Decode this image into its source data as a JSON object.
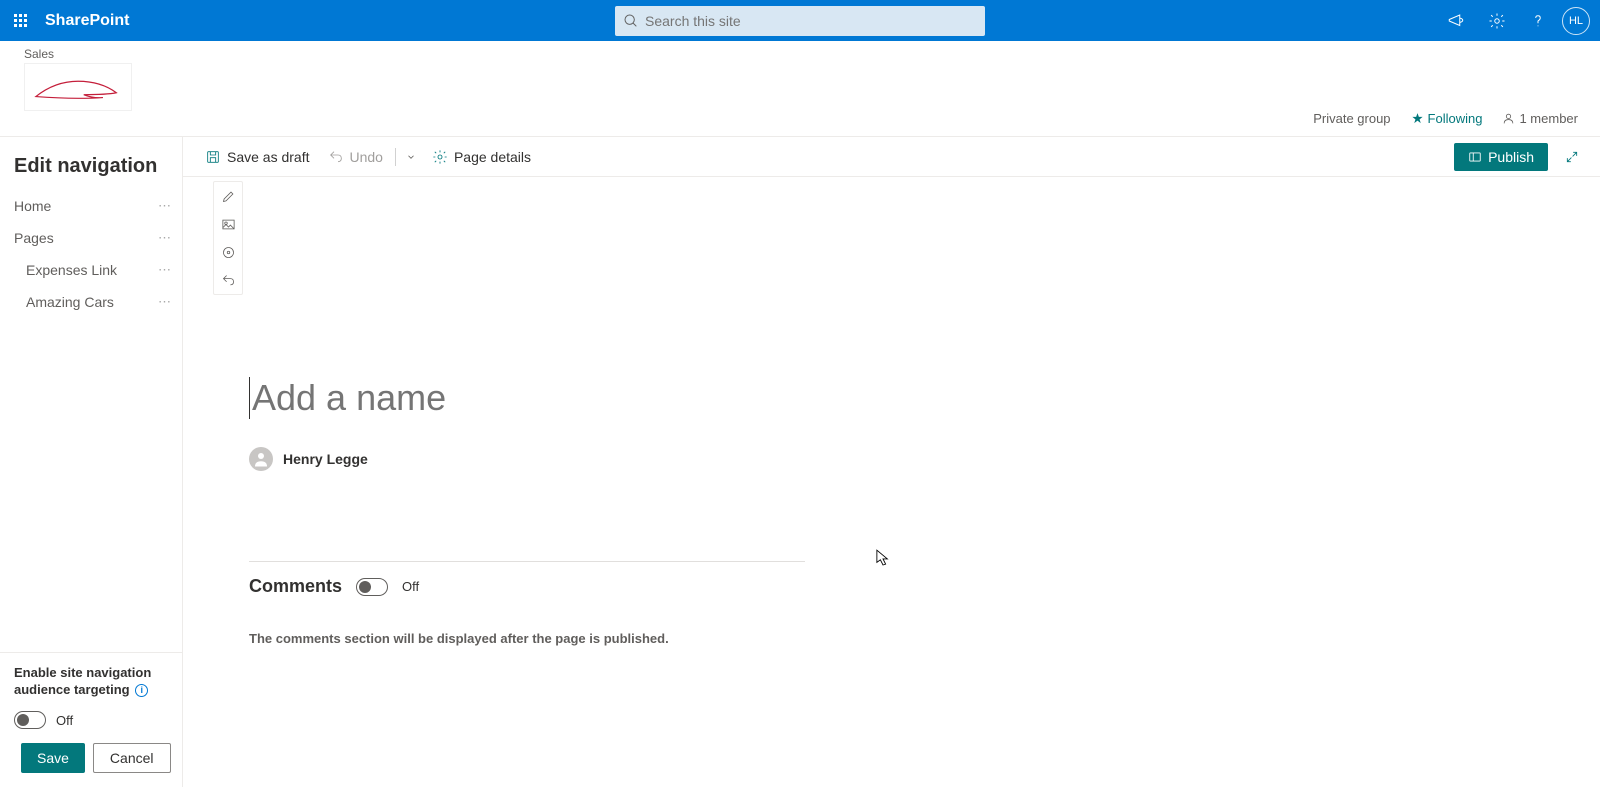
{
  "suiteBar": {
    "appTitle": "SharePoint",
    "searchPlaceholder": "Search this site",
    "userInitials": "HL"
  },
  "site": {
    "name": "Sales",
    "groupType": "Private group",
    "following": "Following",
    "members": "1 member"
  },
  "navPanel": {
    "title": "Edit navigation",
    "items": [
      {
        "label": "Home",
        "indent": false
      },
      {
        "label": "Pages",
        "indent": false
      },
      {
        "label": "Expenses Link",
        "indent": true
      },
      {
        "label": "Amazing Cars",
        "indent": true
      }
    ],
    "audienceLabel": "Enable site navigation audience targeting",
    "audienceToggleState": "Off",
    "saveLabel": "Save",
    "cancelLabel": "Cancel"
  },
  "cmdBar": {
    "saveAsDraft": "Save as draft",
    "undo": "Undo",
    "pageDetails": "Page details",
    "publish": "Publish"
  },
  "page": {
    "titlePlaceholder": "Add a name",
    "authorName": "Henry Legge"
  },
  "comments": {
    "heading": "Comments",
    "toggleState": "Off",
    "note": "The comments section will be displayed after the page is published."
  }
}
